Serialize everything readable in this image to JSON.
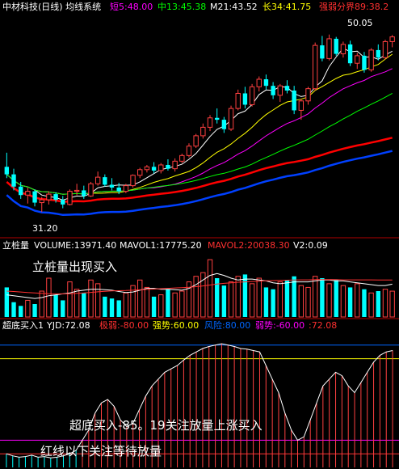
{
  "header": {
    "title": "中材科技(日线) 均线系统",
    "ma_short": "短5:48.00",
    "ma_mid": "中13:45.38",
    "ma_m": "M21:43.52",
    "ma_long": "长34:41.75",
    "divide": "强弱分界89:38.2"
  },
  "vol_header": {
    "title": "立桩量",
    "volume": "VOLUME:13971.40",
    "mavol1": "MAVOL1:17775.20",
    "mavol2": "MAVOL2:20038.30",
    "v2": "V2:0.09"
  },
  "ind_header": {
    "title": "超底买入1",
    "yjd": "YJD:72.08",
    "jiruo": "极弱:-80.00",
    "qiangshi": "强势:60.00",
    "fengxian": "风险:80.00",
    "ruoshi": "弱势:-60.00",
    "tail": ":72.08"
  },
  "annotations": {
    "high_price": "50.05",
    "low_price": "31.20",
    "vol_note": "立桩量出现买入",
    "ind_note": "超底买入-85。19关注放量上涨买入",
    "redline_note": "红线以下关注等待放量"
  },
  "colors": {
    "up": "#ff4040",
    "down": "#00ffff",
    "ma5": "#ffffff",
    "ma13": "#ffff00",
    "ma21": "#ff00ff",
    "ma34": "#00ff00",
    "ma89": "#ff0000",
    "ma_blue": "#0040ff",
    "frame": "#b00000"
  },
  "chart_data": [
    {
      "type": "candlestick",
      "title": "中材科技(日线) 均线系统",
      "ylim": [
        29.5,
        52
      ],
      "candles": [
        [
          36,
          37.5,
          34.8,
          35.2
        ],
        [
          35.2,
          35.8,
          33.5,
          33.9
        ],
        [
          33.9,
          34.4,
          32.6,
          33.0
        ],
        [
          33.0,
          33.8,
          32.1,
          33.4
        ],
        [
          33.4,
          33.6,
          31.8,
          32.2
        ],
        [
          32.2,
          32.8,
          31.2,
          32.5
        ],
        [
          32.5,
          33.4,
          32.0,
          33.1
        ],
        [
          33.1,
          33.3,
          32.2,
          32.5
        ],
        [
          32.5,
          32.9,
          31.6,
          32.0
        ],
        [
          32.0,
          33.6,
          31.9,
          33.4
        ],
        [
          33.4,
          34.2,
          33.0,
          33.5
        ],
        [
          33.5,
          34.0,
          32.6,
          32.9
        ],
        [
          32.9,
          34.4,
          32.8,
          34.2
        ],
        [
          34.2,
          35.5,
          34.0,
          34.9
        ],
        [
          34.9,
          35.2,
          33.9,
          34.1
        ],
        [
          34.1,
          34.8,
          33.5,
          33.8
        ],
        [
          33.8,
          34.3,
          33.1,
          33.4
        ],
        [
          33.4,
          34.2,
          33.2,
          34.0
        ],
        [
          34.0,
          35.2,
          33.8,
          35.1
        ],
        [
          35.1,
          35.9,
          34.8,
          35.7
        ],
        [
          35.7,
          36.2,
          35.4,
          36.0
        ],
        [
          36.0,
          36.5,
          35.3,
          35.6
        ],
        [
          35.6,
          36.4,
          35.3,
          36.2
        ],
        [
          36.2,
          36.8,
          35.6,
          35.8
        ],
        [
          35.8,
          36.9,
          35.5,
          36.6
        ],
        [
          36.6,
          37.4,
          36.4,
          37.2
        ],
        [
          37.2,
          38.5,
          37.0,
          38.2
        ],
        [
          38.2,
          39.5,
          38.0,
          39.3
        ],
        [
          39.3,
          40.6,
          39.0,
          40.2
        ],
        [
          40.2,
          41.5,
          39.8,
          41.2
        ],
        [
          41.2,
          42.2,
          40.6,
          41.0
        ],
        [
          41.0,
          41.3,
          39.6,
          40.0
        ],
        [
          40.0,
          42.5,
          39.8,
          42.2
        ],
        [
          42.2,
          44.2,
          42.0,
          43.8
        ],
        [
          43.8,
          44.5,
          42.2,
          42.6
        ],
        [
          42.6,
          44.8,
          42.4,
          44.5
        ],
        [
          44.5,
          45.6,
          44.0,
          45.3
        ],
        [
          45.3,
          45.8,
          44.2,
          44.6
        ],
        [
          44.6,
          45.0,
          43.2,
          43.6
        ],
        [
          43.6,
          44.8,
          42.9,
          44.6
        ],
        [
          44.6,
          45.2,
          43.8,
          44.1
        ],
        [
          44.1,
          44.6,
          41.6,
          42.0
        ],
        [
          42.0,
          43.2,
          41.0,
          43.0
        ],
        [
          43.0,
          44.5,
          42.6,
          44.3
        ],
        [
          44.3,
          49.2,
          44.1,
          48.9
        ],
        [
          48.9,
          49.9,
          47.2,
          47.5
        ],
        [
          47.5,
          50.05,
          47.3,
          49.6
        ],
        [
          49.6,
          49.8,
          47.8,
          48.0
        ],
        [
          48.0,
          49.3,
          47.6,
          49.0
        ],
        [
          49.0,
          49.4,
          46.7,
          47.0
        ],
        [
          47.0,
          48.1,
          46.4,
          47.8
        ],
        [
          47.8,
          48.2,
          46.0,
          46.3
        ],
        [
          46.3,
          48.6,
          46.1,
          48.4
        ],
        [
          48.4,
          49.0,
          47.3,
          47.6
        ],
        [
          47.6,
          49.5,
          47.4,
          49.3
        ],
        [
          49.3,
          50.0,
          48.7,
          49.8
        ]
      ]
    },
    {
      "type": "bar",
      "title": "立桩量",
      "ylim": [
        0,
        35000
      ],
      "values": [
        16000,
        8000,
        6000,
        9000,
        7000,
        14000,
        21000,
        12000,
        9000,
        19000,
        15000,
        13000,
        20000,
        18000,
        11000,
        10000,
        9000,
        13000,
        17000,
        20000,
        16000,
        11000,
        12000,
        15000,
        13000,
        14000,
        19000,
        22000,
        24000,
        31000,
        21000,
        17000,
        19000,
        22000,
        23000,
        18000,
        21000,
        16000,
        15000,
        19000,
        20000,
        22000,
        17000,
        16000,
        22000,
        21000,
        18000,
        20000,
        17000,
        16000,
        18000,
        15000,
        13000,
        14000,
        15000,
        13971
      ],
      "mavol1": [
        12000,
        11500,
        11000,
        10500,
        10000,
        10500,
        11500,
        12000,
        12500,
        13000,
        14000,
        14500,
        15000,
        15000,
        14800,
        14500,
        13800,
        13200,
        13500,
        14500,
        15500,
        15500,
        15000,
        15000,
        14800,
        14500,
        15500,
        17500,
        20000,
        22500,
        23500,
        22500,
        21000,
        20000,
        20500,
        20500,
        20000,
        19500,
        18500,
        18000,
        18500,
        19000,
        19000,
        19000,
        19500,
        20000,
        20000,
        19500,
        19500,
        19000,
        18500,
        18000,
        17500,
        17000,
        17000,
        17775.2
      ],
      "mavol2": [
        14000,
        13800,
        13500,
        13200,
        13000,
        12800,
        12600,
        12500,
        12500,
        12600,
        12800,
        13000,
        13300,
        13600,
        13900,
        14100,
        14200,
        14300,
        14500,
        14700,
        14900,
        15100,
        15300,
        15500,
        15700,
        15900,
        16100,
        16400,
        16800,
        17300,
        17800,
        18200,
        18500,
        18800,
        19000,
        19200,
        19400,
        19600,
        19700,
        19800,
        19900,
        20000,
        20100,
        20100,
        20200,
        20200,
        20200,
        20200,
        20100,
        20100,
        20100,
        20100,
        20100,
        20000,
        20000,
        20038.3
      ]
    },
    {
      "type": "bar",
      "title": "超底买入1",
      "ylim": [
        -100,
        100
      ],
      "series": [
        {
          "name": "YJD",
          "values": [
            -80,
            -83,
            -85,
            -84,
            -82,
            -85,
            -84,
            -86,
            -85,
            -83,
            -80,
            -75,
            -60,
            -45,
            -20,
            -5,
            0,
            -10,
            -30,
            -40,
            -35,
            -15,
            5,
            20,
            30,
            40,
            45,
            50,
            58,
            65,
            70,
            75,
            78,
            80,
            82,
            80,
            78,
            75,
            74,
            72,
            70,
            50,
            30,
            10,
            -20,
            -45,
            -60,
            -55,
            -30,
            -5,
            20,
            30,
            40,
            35,
            20,
            10,
            25,
            40,
            55,
            65,
            70,
            72.08
          ]
        }
      ],
      "levels": [
        {
          "name": "极弱",
          "value": -80
        },
        {
          "name": "强势",
          "value": 60
        },
        {
          "name": "风险",
          "value": 80
        },
        {
          "name": "弱势",
          "value": -60
        }
      ]
    }
  ]
}
